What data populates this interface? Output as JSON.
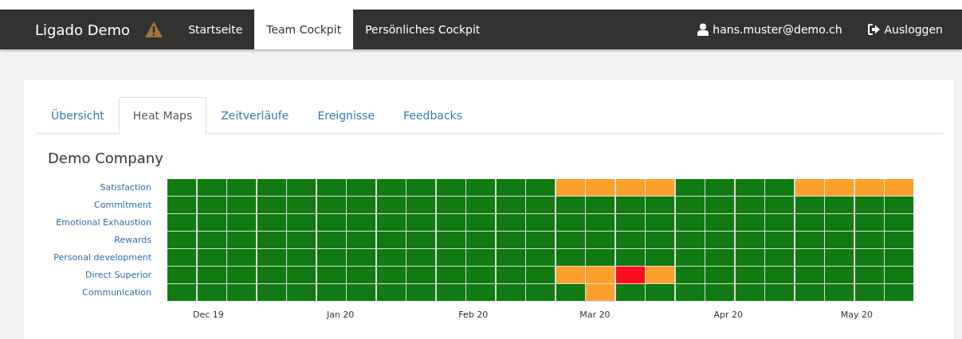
{
  "navbar": {
    "brand": "Ligado Demo",
    "items": [
      {
        "label": "Startseite",
        "selected": false
      },
      {
        "label": "Team Cockpit",
        "selected": true
      },
      {
        "label": "Persönliches Cockpit",
        "selected": false
      }
    ],
    "user": "hans.muster@demo.ch",
    "logout": "Ausloggen"
  },
  "tabs": [
    {
      "label": "Übersicht",
      "selected": false
    },
    {
      "label": "Heat Maps",
      "selected": true
    },
    {
      "label": "Zeitverläufe",
      "selected": false
    },
    {
      "label": "Ereignisse",
      "selected": false
    },
    {
      "label": "Feedbacks",
      "selected": false
    }
  ],
  "title": "Demo Company",
  "heatmap": {
    "rows": [
      {
        "label": "Satisfaction",
        "cells": [
          {
            "color": "#117a11"
          },
          {
            "color": "#117a11"
          },
          {
            "color": "#117a11"
          },
          {
            "color": "#117a11"
          },
          {
            "color": "#117a11"
          },
          {
            "color": "#117a11"
          },
          {
            "color": "#117a11"
          },
          {
            "color": "#117a11"
          },
          {
            "color": "#117a11"
          },
          {
            "color": "#117a11"
          },
          {
            "color": "#117a11"
          },
          {
            "color": "#117a11"
          },
          {
            "color": "#117a11"
          },
          {
            "color": "#fba12b"
          },
          {
            "color": "#fba12b"
          },
          {
            "color": "#fba12b"
          },
          {
            "color": "#fba12b"
          },
          {
            "color": "#117a11"
          },
          {
            "color": "#117a11"
          },
          {
            "color": "#117a11"
          },
          {
            "color": "#117a11"
          },
          {
            "color": "#fba12b"
          },
          {
            "color": "#fba12b"
          },
          {
            "color": "#fba12b"
          },
          {
            "color": "#fba12b"
          }
        ]
      },
      {
        "label": "Commitment",
        "cells": [
          {
            "color": "#117a11"
          },
          {
            "color": "#117a11"
          },
          {
            "color": "#117a11"
          },
          {
            "color": "#117a11"
          },
          {
            "color": "#117a11"
          },
          {
            "color": "#117a11"
          },
          {
            "color": "#117a11"
          },
          {
            "color": "#117a11"
          },
          {
            "color": "#117a11"
          },
          {
            "color": "#117a11"
          },
          {
            "color": "#117a11"
          },
          {
            "color": "#117a11"
          },
          {
            "color": "#117a11"
          },
          {
            "color": "#117a11"
          },
          {
            "color": "#117a11"
          },
          {
            "color": "#117a11"
          },
          {
            "color": "#117a11"
          },
          {
            "color": "#117a11"
          },
          {
            "color": "#117a11"
          },
          {
            "color": "#117a11"
          },
          {
            "color": "#117a11"
          },
          {
            "color": "#117a11"
          },
          {
            "color": "#117a11"
          },
          {
            "color": "#117a11"
          },
          {
            "color": "#117a11"
          }
        ]
      },
      {
        "label": "Emotional Exhaustion",
        "cells": [
          {
            "color": "#117a11"
          },
          {
            "color": "#117a11"
          },
          {
            "color": "#117a11"
          },
          {
            "color": "#117a11"
          },
          {
            "color": "#117a11"
          },
          {
            "color": "#117a11"
          },
          {
            "color": "#117a11"
          },
          {
            "color": "#117a11"
          },
          {
            "color": "#117a11"
          },
          {
            "color": "#117a11"
          },
          {
            "color": "#117a11"
          },
          {
            "color": "#117a11"
          },
          {
            "color": "#117a11"
          },
          {
            "color": "#117a11"
          },
          {
            "color": "#117a11"
          },
          {
            "color": "#117a11"
          },
          {
            "color": "#117a11"
          },
          {
            "color": "#117a11"
          },
          {
            "color": "#117a11"
          },
          {
            "color": "#117a11"
          },
          {
            "color": "#117a11"
          },
          {
            "color": "#117a11"
          },
          {
            "color": "#117a11"
          },
          {
            "color": "#117a11"
          },
          {
            "color": "#117a11"
          }
        ]
      },
      {
        "label": "Rewards",
        "cells": [
          {
            "color": "#117a11"
          },
          {
            "color": "#117a11"
          },
          {
            "color": "#117a11"
          },
          {
            "color": "#117a11"
          },
          {
            "color": "#117a11"
          },
          {
            "color": "#117a11"
          },
          {
            "color": "#117a11"
          },
          {
            "color": "#117a11"
          },
          {
            "color": "#117a11"
          },
          {
            "color": "#117a11"
          },
          {
            "color": "#117a11"
          },
          {
            "color": "#117a11"
          },
          {
            "color": "#117a11"
          },
          {
            "color": "#117a11"
          },
          {
            "color": "#117a11"
          },
          {
            "color": "#117a11"
          },
          {
            "color": "#117a11"
          },
          {
            "color": "#117a11"
          },
          {
            "color": "#117a11"
          },
          {
            "color": "#117a11"
          },
          {
            "color": "#117a11"
          },
          {
            "color": "#117a11"
          },
          {
            "color": "#117a11"
          },
          {
            "color": "#117a11"
          },
          {
            "color": "#117a11"
          }
        ]
      },
      {
        "label": "Personal development",
        "cells": [
          {
            "color": "#117a11"
          },
          {
            "color": "#117a11"
          },
          {
            "color": "#117a11"
          },
          {
            "color": "#117a11"
          },
          {
            "color": "#117a11"
          },
          {
            "color": "#117a11"
          },
          {
            "color": "#117a11"
          },
          {
            "color": "#117a11"
          },
          {
            "color": "#117a11"
          },
          {
            "color": "#117a11"
          },
          {
            "color": "#117a11"
          },
          {
            "color": "#117a11"
          },
          {
            "color": "#117a11"
          },
          {
            "color": "#117a11"
          },
          {
            "color": "#117a11"
          },
          {
            "color": "#117a11"
          },
          {
            "color": "#117a11"
          },
          {
            "color": "#117a11"
          },
          {
            "color": "#117a11"
          },
          {
            "color": "#117a11"
          },
          {
            "color": "#117a11"
          },
          {
            "color": "#117a11"
          },
          {
            "color": "#117a11"
          },
          {
            "color": "#117a11"
          },
          {
            "color": "#117a11"
          }
        ]
      },
      {
        "label": "Direct Superior",
        "cells": [
          {
            "color": "#117a11"
          },
          {
            "color": "#117a11"
          },
          {
            "color": "#117a11"
          },
          {
            "color": "#117a11"
          },
          {
            "color": "#117a11"
          },
          {
            "color": "#117a11"
          },
          {
            "color": "#117a11"
          },
          {
            "color": "#117a11"
          },
          {
            "color": "#117a11"
          },
          {
            "color": "#117a11"
          },
          {
            "color": "#117a11"
          },
          {
            "color": "#117a11"
          },
          {
            "color": "#117a11"
          },
          {
            "color": "#fba12b"
          },
          {
            "color": "#fba12b"
          },
          {
            "color": "#fb0d1c"
          },
          {
            "color": "#fba12b"
          },
          {
            "color": "#117a11"
          },
          {
            "color": "#117a11"
          },
          {
            "color": "#117a11"
          },
          {
            "color": "#117a11"
          },
          {
            "color": "#117a11"
          },
          {
            "color": "#117a11"
          },
          {
            "color": "#117a11"
          },
          {
            "color": "#117a11"
          }
        ]
      },
      {
        "label": "Communication",
        "cells": [
          {
            "color": "#117a11"
          },
          {
            "color": "#117a11"
          },
          {
            "color": "#117a11"
          },
          {
            "color": "#117a11"
          },
          {
            "color": "#117a11"
          },
          {
            "color": "#117a11"
          },
          {
            "color": "#117a11"
          },
          {
            "color": "#117a11"
          },
          {
            "color": "#117a11"
          },
          {
            "color": "#117a11"
          },
          {
            "color": "#117a11"
          },
          {
            "color": "#117a11"
          },
          {
            "color": "#117a11"
          },
          {
            "color": "#117a11"
          },
          {
            "color": "#fba12b"
          },
          {
            "color": "#117a11"
          },
          {
            "color": "#117a11"
          },
          {
            "color": "#117a11"
          },
          {
            "color": "#117a11"
          },
          {
            "color": "#117a11"
          },
          {
            "color": "#117a11"
          },
          {
            "color": "#117a11"
          },
          {
            "color": "#117a11"
          },
          {
            "color": "#117a11"
          },
          {
            "color": "#117a11"
          }
        ]
      }
    ],
    "x_labels": [
      "Dec 19",
      "Jan 20",
      "Feb 20",
      "Mar 20",
      "Apr 20",
      "May 20"
    ]
  }
}
